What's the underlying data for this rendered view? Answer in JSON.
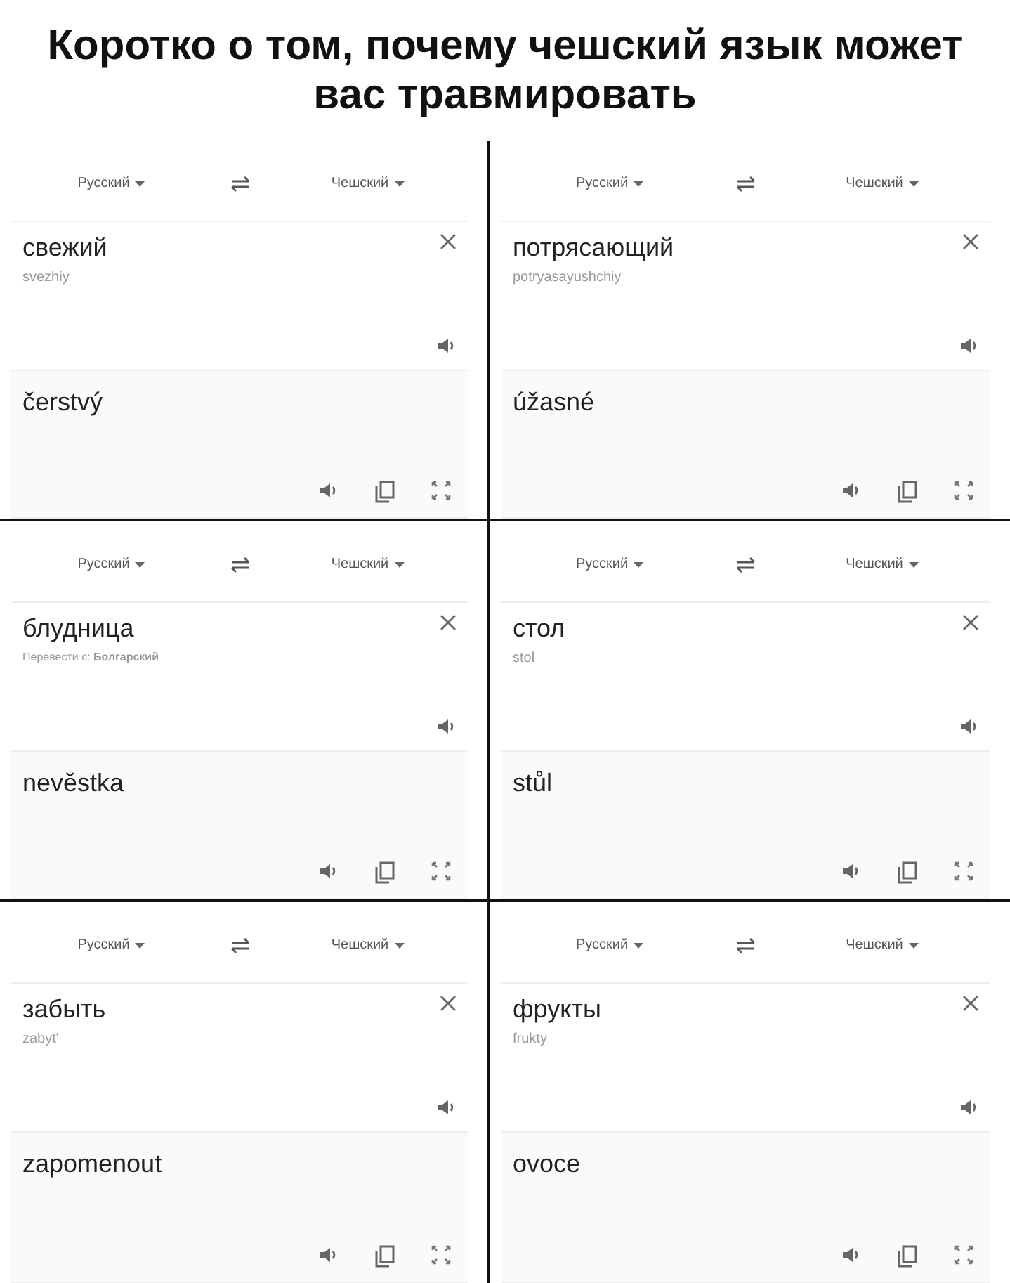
{
  "title": "Коротко о том, почему чешский язык может вас травмировать",
  "panels": [
    {
      "source_lang": "Русский",
      "target_lang": "Чешский",
      "input": "свежий",
      "hint": {
        "kind": "translit",
        "text": "svezhiy"
      },
      "output": "čerstvý"
    },
    {
      "source_lang": "Русский",
      "target_lang": "Чешский",
      "input": "потрясающий",
      "hint": {
        "kind": "translit",
        "text": "potryasayushchiy"
      },
      "output": "úžasné"
    },
    {
      "source_lang": "Русский",
      "target_lang": "Чешский",
      "input": "блудница",
      "hint": {
        "kind": "detect",
        "text": "Перевести с: **Болгарский**"
      },
      "output": "nevěstka"
    },
    {
      "source_lang": "Русский",
      "target_lang": "Чешский",
      "input": "стол",
      "hint": {
        "kind": "translit",
        "text": "stol"
      },
      "output": "stůl"
    },
    {
      "source_lang": "Русский",
      "target_lang": "Чешский",
      "input": "забыть",
      "hint": {
        "kind": "translit",
        "text": "zabyt'"
      },
      "output": "zapomenout"
    },
    {
      "source_lang": "Русский",
      "target_lang": "Чешский",
      "input": "фрукты",
      "hint": {
        "kind": "translit",
        "text": "frukty"
      },
      "output": "ovoce"
    }
  ]
}
